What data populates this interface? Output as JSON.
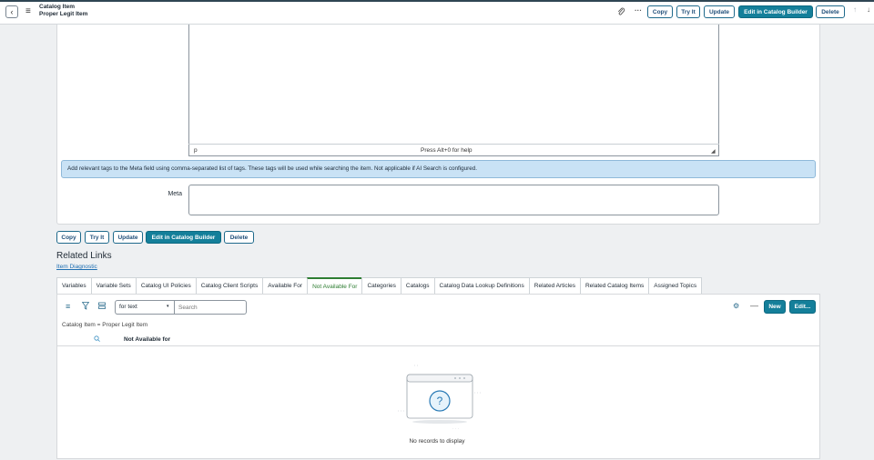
{
  "header": {
    "record_type": "Catalog Item",
    "record_name": "Proper Legit Item",
    "buttons": {
      "copy": "Copy",
      "try_it": "Try It",
      "update": "Update",
      "edit_builder": "Edit in Catalog Builder",
      "delete": "Delete"
    }
  },
  "editor": {
    "path": "p",
    "help": "Press Alt+0 for help"
  },
  "info_message": "Add relevant tags to the Meta field using comma-separated list of tags. These tags will be used while searching the item. Not applicable if AI Search is configured.",
  "meta": {
    "label": "Meta",
    "value": ""
  },
  "form_buttons": {
    "copy": "Copy",
    "try_it": "Try It",
    "update": "Update",
    "edit_builder": "Edit in Catalog Builder",
    "delete": "Delete"
  },
  "related_links": {
    "title": "Related Links",
    "items": [
      "Item Diagnostic"
    ]
  },
  "tabs": [
    {
      "label": "Variables",
      "active": false
    },
    {
      "label": "Variable Sets",
      "active": false
    },
    {
      "label": "Catalog UI Policies",
      "active": false
    },
    {
      "label": "Catalog Client Scripts",
      "active": false
    },
    {
      "label": "Available For",
      "active": false
    },
    {
      "label": "Not Available For",
      "active": true
    },
    {
      "label": "Categories",
      "active": false
    },
    {
      "label": "Catalogs",
      "active": false
    },
    {
      "label": "Catalog Data Lookup Definitions",
      "active": false
    },
    {
      "label": "Related Articles",
      "active": false
    },
    {
      "label": "Related Catalog Items",
      "active": false
    },
    {
      "label": "Assigned Topics",
      "active": false
    }
  ],
  "list": {
    "for_select": "for text",
    "search_placeholder": "Search",
    "new_label": "New",
    "edit_label": "Edit...",
    "breadcrumb": "Catalog Item = Proper Legit Item",
    "column": "Not Available for",
    "empty_text": "No records to display"
  },
  "colors": {
    "primary": "#147f9a",
    "active_tab": "#2e7d32",
    "info_bg": "#c9e2f5"
  }
}
